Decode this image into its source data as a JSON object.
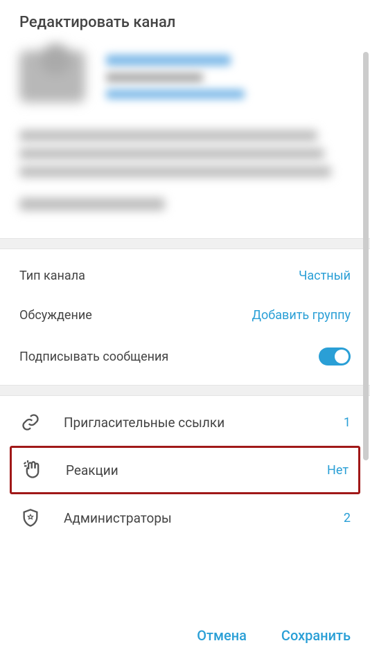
{
  "header": {
    "title": "Редактировать канал"
  },
  "settings": {
    "channel_type": {
      "label": "Тип канала",
      "value": "Частный"
    },
    "discussion": {
      "label": "Обсуждение",
      "value": "Добавить группу"
    },
    "sign_messages": {
      "label": "Подписывать сообщения",
      "enabled": true
    }
  },
  "menu": {
    "invite_links": {
      "label": "Пригласительные ссылки",
      "value": "1"
    },
    "reactions": {
      "label": "Реакции",
      "value": "Нет"
    },
    "administrators": {
      "label": "Администраторы",
      "value": "2"
    }
  },
  "footer": {
    "cancel": "Отмена",
    "save": "Сохранить"
  }
}
